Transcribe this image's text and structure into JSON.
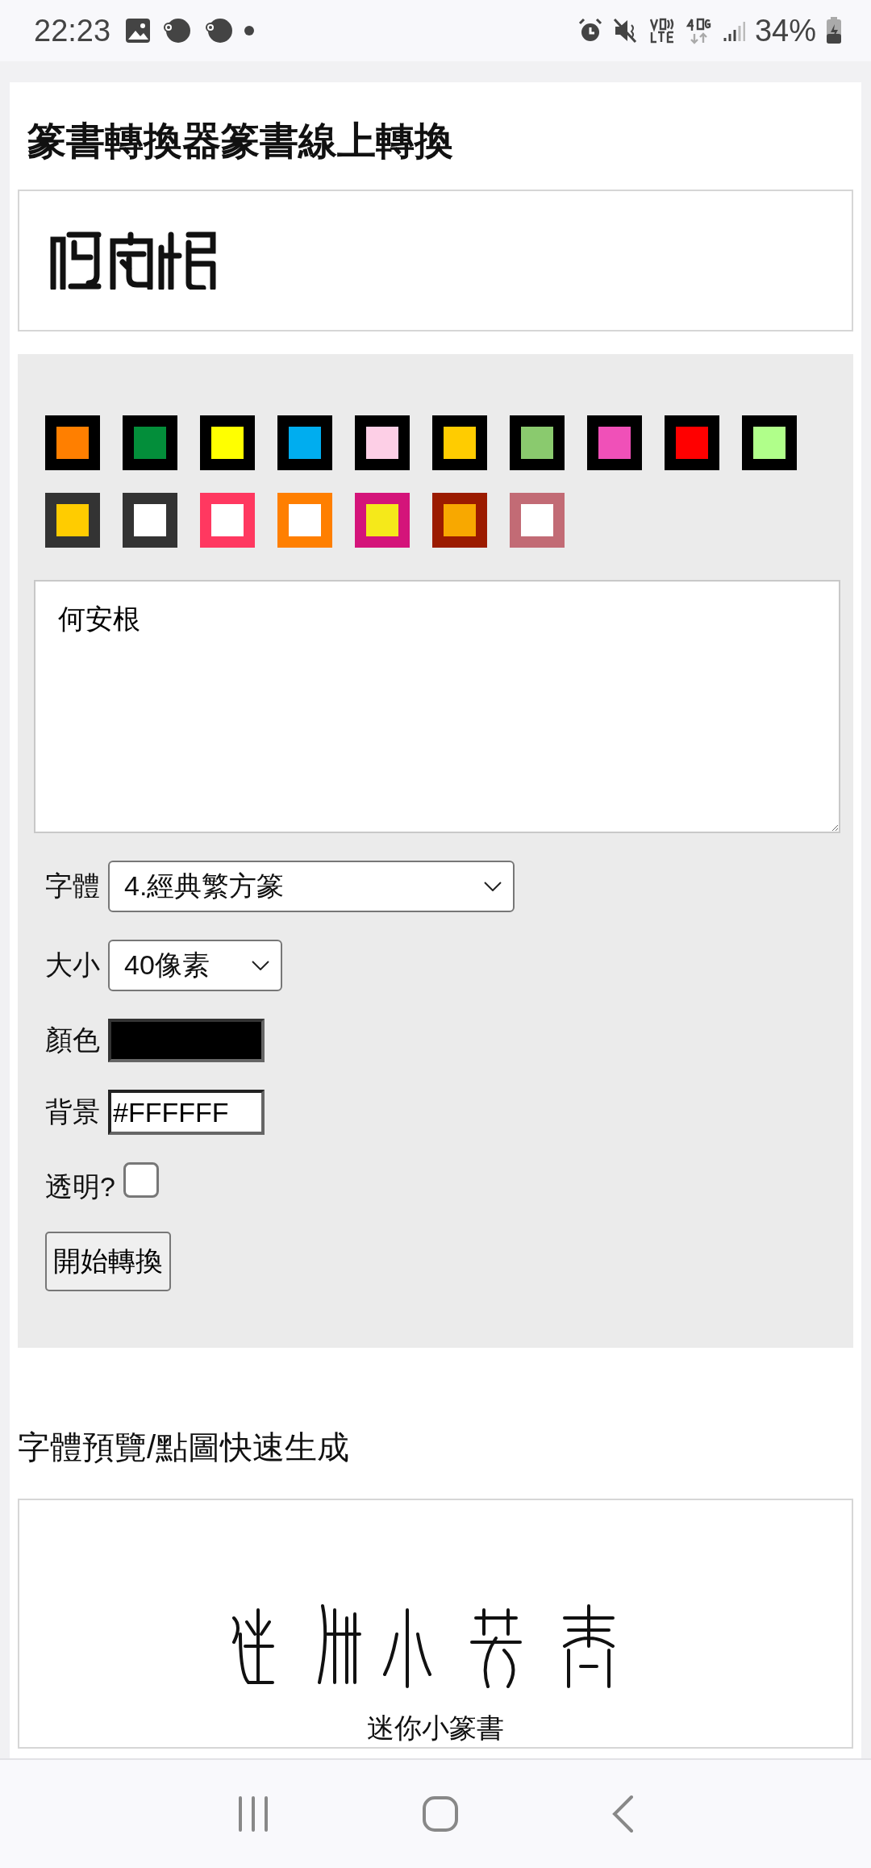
{
  "status_bar": {
    "time": "22:23",
    "battery": "34%"
  },
  "title": "篆書轉換器篆書線上轉換",
  "swatches": [
    {
      "color": "#ff7f00",
      "frame": {
        "color": "#000000"
      }
    },
    {
      "color": "#038e3a",
      "frame": {
        "color": "#000000"
      }
    },
    {
      "color": "#ffff00",
      "frame": {
        "color": "#000000"
      }
    },
    {
      "color": "#00adef",
      "frame": {
        "color": "#000000"
      }
    },
    {
      "color": "#fdcfe6",
      "frame": {
        "color": "#000000"
      }
    },
    {
      "color": "#ffcc00",
      "frame": {
        "color": "#000000"
      }
    },
    {
      "color": "#8aca6e",
      "frame": {
        "color": "#000000"
      }
    },
    {
      "color": "#f050b8",
      "frame": {
        "color": "#000000"
      }
    },
    {
      "color": "#ff0000",
      "frame": {
        "color": "#000000"
      }
    },
    {
      "color": "#b0ff8a",
      "frame": {
        "color": "#000000"
      }
    },
    {
      "color": "#ffcc00",
      "frame": {
        "color": "#333333"
      }
    },
    {
      "color": "#ffffff",
      "frame": {
        "color": "#333333"
      }
    },
    {
      "color": "#ffffff",
      "frame": {
        "color": "#ff3860"
      }
    },
    {
      "color": "#ffffff",
      "frame": {
        "color": "#ff7f00"
      }
    },
    {
      "color": "#f5e91a",
      "frame": {
        "color": "#d4147a"
      }
    },
    {
      "color": "#f8a800",
      "frame": {
        "color": "#9b1b00"
      }
    },
    {
      "color": "#ffffff",
      "frame": {
        "color": "#c26b75"
      }
    }
  ],
  "text_input": {
    "value": "何安根"
  },
  "fields": [
    {
      "kind": "select",
      "label": "字體",
      "value": "4.經典繁方篆",
      "wide": true
    },
    {
      "kind": "select",
      "label": "大小",
      "value": "40像素",
      "wide": false
    },
    {
      "kind": "color",
      "label": "顏色",
      "color": "#000000"
    },
    {
      "kind": "text",
      "label": "背景",
      "value": "#FFFFFF"
    },
    {
      "kind": "checkbox",
      "label": "透明?",
      "checked": false
    }
  ],
  "convert_button": "開始轉換",
  "preview_heading": "字體預覽/點圖快速生成",
  "previews": [
    {
      "kind": "picture",
      "caption": "迷你小篆書"
    }
  ]
}
